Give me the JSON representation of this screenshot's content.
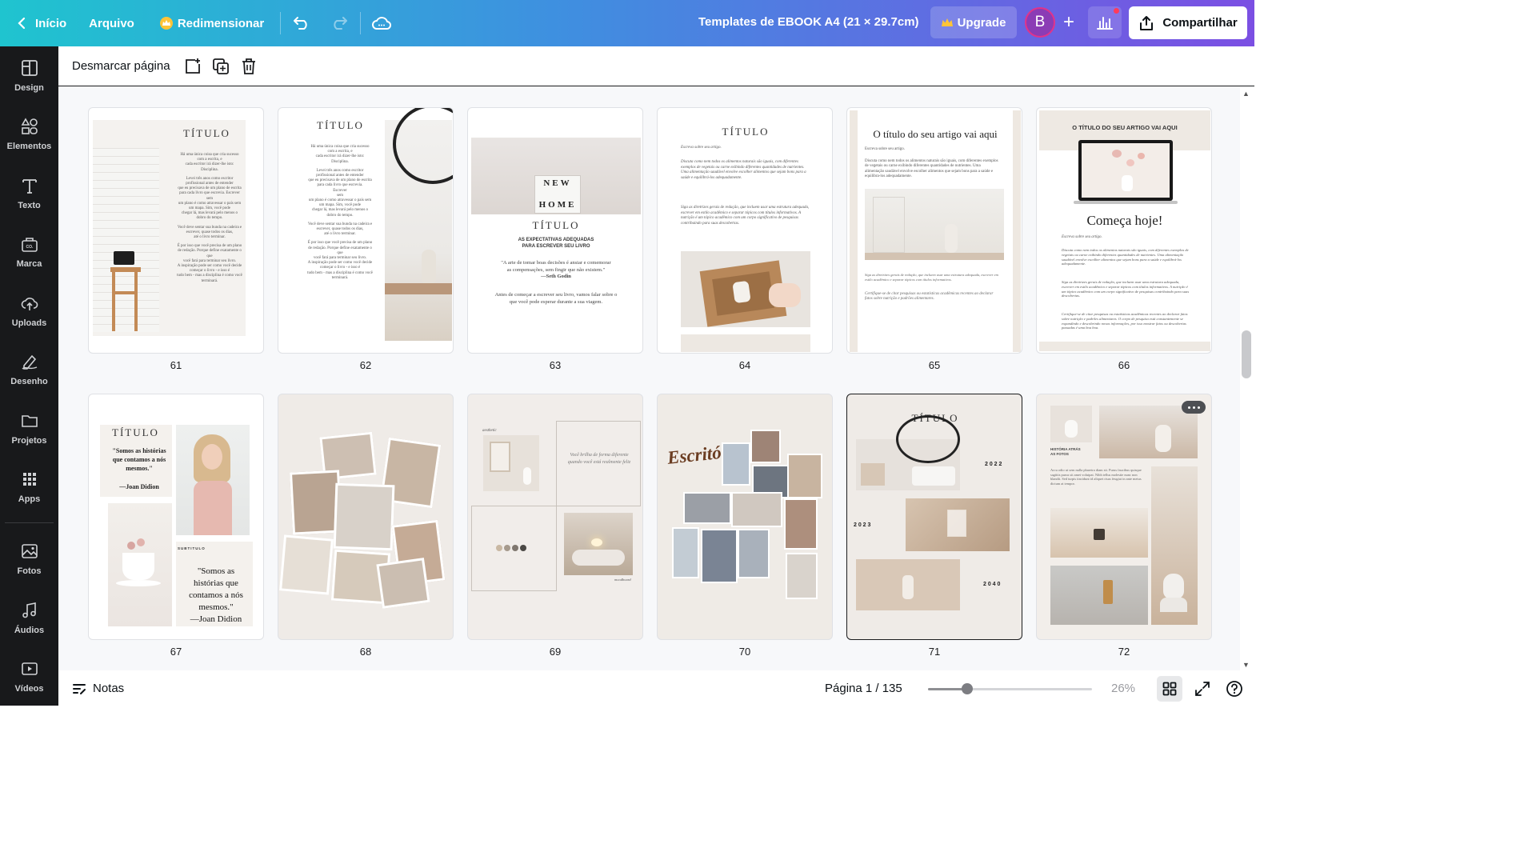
{
  "topbar": {
    "home_label": "Início",
    "file_label": "Arquivo",
    "resize_label": "Redimensionar",
    "doc_title": "Templates de EBOOK A4 (21 × 29.7cm)",
    "upgrade_label": "Upgrade",
    "avatar_initial": "B",
    "share_label": "Compartilhar"
  },
  "sidebar": {
    "items": [
      {
        "label": "Design",
        "icon": "layout-icon"
      },
      {
        "label": "Elementos",
        "icon": "shapes-icon"
      },
      {
        "label": "Texto",
        "icon": "text-icon"
      },
      {
        "label": "Marca",
        "icon": "brand-icon"
      },
      {
        "label": "Uploads",
        "icon": "upload-cloud-icon"
      },
      {
        "label": "Desenho",
        "icon": "draw-icon"
      },
      {
        "label": "Projetos",
        "icon": "folder-icon"
      },
      {
        "label": "Apps",
        "icon": "apps-grid-icon"
      },
      {
        "label": "Fotos",
        "icon": "photo-icon"
      },
      {
        "label": "Áudios",
        "icon": "music-icon"
      },
      {
        "label": "Vídeos",
        "icon": "video-icon"
      }
    ]
  },
  "toolbar2": {
    "unmark_label": "Desmarcar página"
  },
  "pages": {
    "p61": {
      "num": "61",
      "title": "TÍTULO",
      "lines": [
        "Há uma única coisa que cria sucesso",
        "com a escrita, e",
        "cada escritor irá dizer-lhe isto:",
        "Disciplina.",
        "Levei três anos como escritor",
        "profissional antes de entender",
        "que eu precisava de um plano de escrita",
        "para cada livro que escrevia. Escrever",
        "sem",
        "um plano é como atravessar o país sem",
        "um mapa. Sim, você pode",
        "chegar lá, mas levará pelo menos o",
        "dobro do tempo.",
        "Você deve sentar sua bunda na cadeira e",
        "escrever, quase todos os dias,",
        "até o livro terminar.",
        "É por isso que você precisa de um plano",
        "de redação. Porque define exatamente o",
        "que",
        "você fará para terminar seu livro.",
        "A inspiração pode ser como você decide",
        "começar o livro - e isso é",
        "tudo bem - mas a disciplina é como você",
        "terminará."
      ]
    },
    "p62": {
      "num": "62",
      "title": "TÍTULO",
      "lines": [
        "Há uma única coisa que cria sucesso",
        "com a escrita, e",
        "cada escritor irá dizer-lhe isto:",
        "Disciplina.",
        "Levei três anos como escritor",
        "profissional antes de entender",
        "que eu precisava de um plano de escrita",
        "para cada livro que escrevia.",
        "Escrever",
        "sem",
        "um plano é como atravessar o país sem",
        "um mapa. Sim, você pode",
        "chegar lá, mas levará pelo menos o",
        "dobro do tempo.",
        "Você deve sentar sua bunda na cadeira e",
        "escrever, quase todos os dias,",
        "até o livro terminar.",
        "É por isso que você precisa de um plano",
        "de redação. Porque define exatamente o",
        "que",
        "você fará para terminar seu livro.",
        "A inspiração pode ser como você decide",
        "começar o livro - e isso é",
        "tudo bem - mas a disciplina é como você",
        "terminará."
      ]
    },
    "p63": {
      "num": "63",
      "sign_line1": "NEW",
      "sign_line2": "HOME",
      "title": "TÍTULO",
      "subtitle1": "AS EXPECTATIVAS ADEQUADAS",
      "subtitle2": "PARA ESCREVER SEU LIVRO",
      "quote1": "\"A arte de tomar boas decisões é ansiar e comemorar",
      "quote2": "as compensações, sem fingir que não existem.\"",
      "quote_author": "—Seth Godin",
      "body1": "Antes de começar a escrever seu livro, vamos falar sobre o",
      "body2": "que você pode esperar durante a sua viagem."
    },
    "p64": {
      "num": "64",
      "title": "TÍTULO",
      "intro": "Escreva sobre seu artigo.",
      "body1": "Discuta como nem todos os alimentos naturais são iguais, com diferentes exemplos de vegetais ou carne exibindo diferentes quantidades de nutrientes. Uma alimentação saudável envolve escolher alimentos que sejam bons para a saúde e equilibrá-los adequadamente.",
      "body2": "Siga as diretrizes gerais de redação, que incluem usar uma estrutura adequada, escrever em estilo acadêmico e separar tópicos com títulos informativos. A nutrição é um tópico acadêmico com um corpo significativo de pesquisas contribuindo para suas descobertas."
    },
    "p65": {
      "num": "65",
      "title": "O título do seu artigo vai aqui",
      "intro": "Escreva sobre seu artigo.",
      "body1": "Discuta como nem todos os alimentos naturais são iguais, com diferentes exemplos de vegetais ou carne exibindo diferentes quantidades de nutrientes. Uma alimentação saudável envolve escolher alimentos que sejam bons para a saúde e equilibra-los adequadamente.",
      "body2": "Siga as diretrizes gerais de redação, que incluem usar uma estrutura adequada, escrever em estilo acadêmico e separar tópicos com títulos informativos.",
      "body3": "Certifique-se de citar pesquisas ou estatísticas acadêmicas recentes ao declarar fatos sobre nutrição e padrões alimentares."
    },
    "p66": {
      "num": "66",
      "title": "O TÍTULO DO SEU ARTIGO VAI AQUI",
      "headline": "Começa hoje!",
      "intro": "Escreva sobre seu artigo.",
      "body1": "Discuta como nem todos os alimentos naturais são iguais, com diferentes exemplos de vegetais ou carne exibindo diferentes quantidades de nutrientes. Uma alimentação saudável envolve escolher alimentos que sejam bons para a saúde e equilibrá-los adequadamente.",
      "body2": "Siga as diretrizes gerais de redação, que incluem usar uma estrutura adequada, escrever em estilo acadêmico e separar tópicos com títulos informativos. A nutrição é um tópico acadêmico com um corpo significativo de pesquisas contribuindo para suas descobertas.",
      "body3": "Certifique-se de citar pesquisas ou estatísticas acadêmicas recentes ao declarar fatos sobre nutrição e padrões alimentares. O corpo de pesquisa está constantemente se expandindo e descobrindo novas informações, por isso mostrar fatos ou descobertas passadas é uma boa boa."
    },
    "p67": {
      "num": "67",
      "title": "TÍTULO",
      "quote_small": "\"Somos as histórias que contamos a nós mesmos.\"",
      "author_small": "—Joan Didion",
      "subtitle": "SUBTITULO",
      "quote_big": "\"Somos as histórias que contamos a nós mesmos.\"",
      "author_big": "—Joan Didion"
    },
    "p68": {
      "num": "68"
    },
    "p69": {
      "num": "69",
      "tag": "aesthetic",
      "quote": "Você brilha de forma diferente quando você está realmente feliz",
      "tag2": "moodboard"
    },
    "p70": {
      "num": "70",
      "script_title": "Escritório"
    },
    "p71": {
      "num": "71",
      "title": "TÍTULO",
      "y1": "2 0 2 2",
      "y2": "2 0 2 3",
      "y3": "2 0 4 0"
    },
    "p72": {
      "num": "72",
      "label": "HISTÓRIA ATRÁS AS FOTOS",
      "body": "Arcu odio ut sem nulla pharetra diam sit. Purus faucibus quisque sagittis purus sit amet volutpat. Nibh tellus molestie nunc non blandit. Sed turpis tincidunt id aliquet risus feugiat in ante metus dictum at tempor."
    }
  },
  "footer": {
    "notes_label": "Notas",
    "page_info": "Página 1 / 135",
    "zoom_level": "26%",
    "zoom_fraction": 0.24
  }
}
